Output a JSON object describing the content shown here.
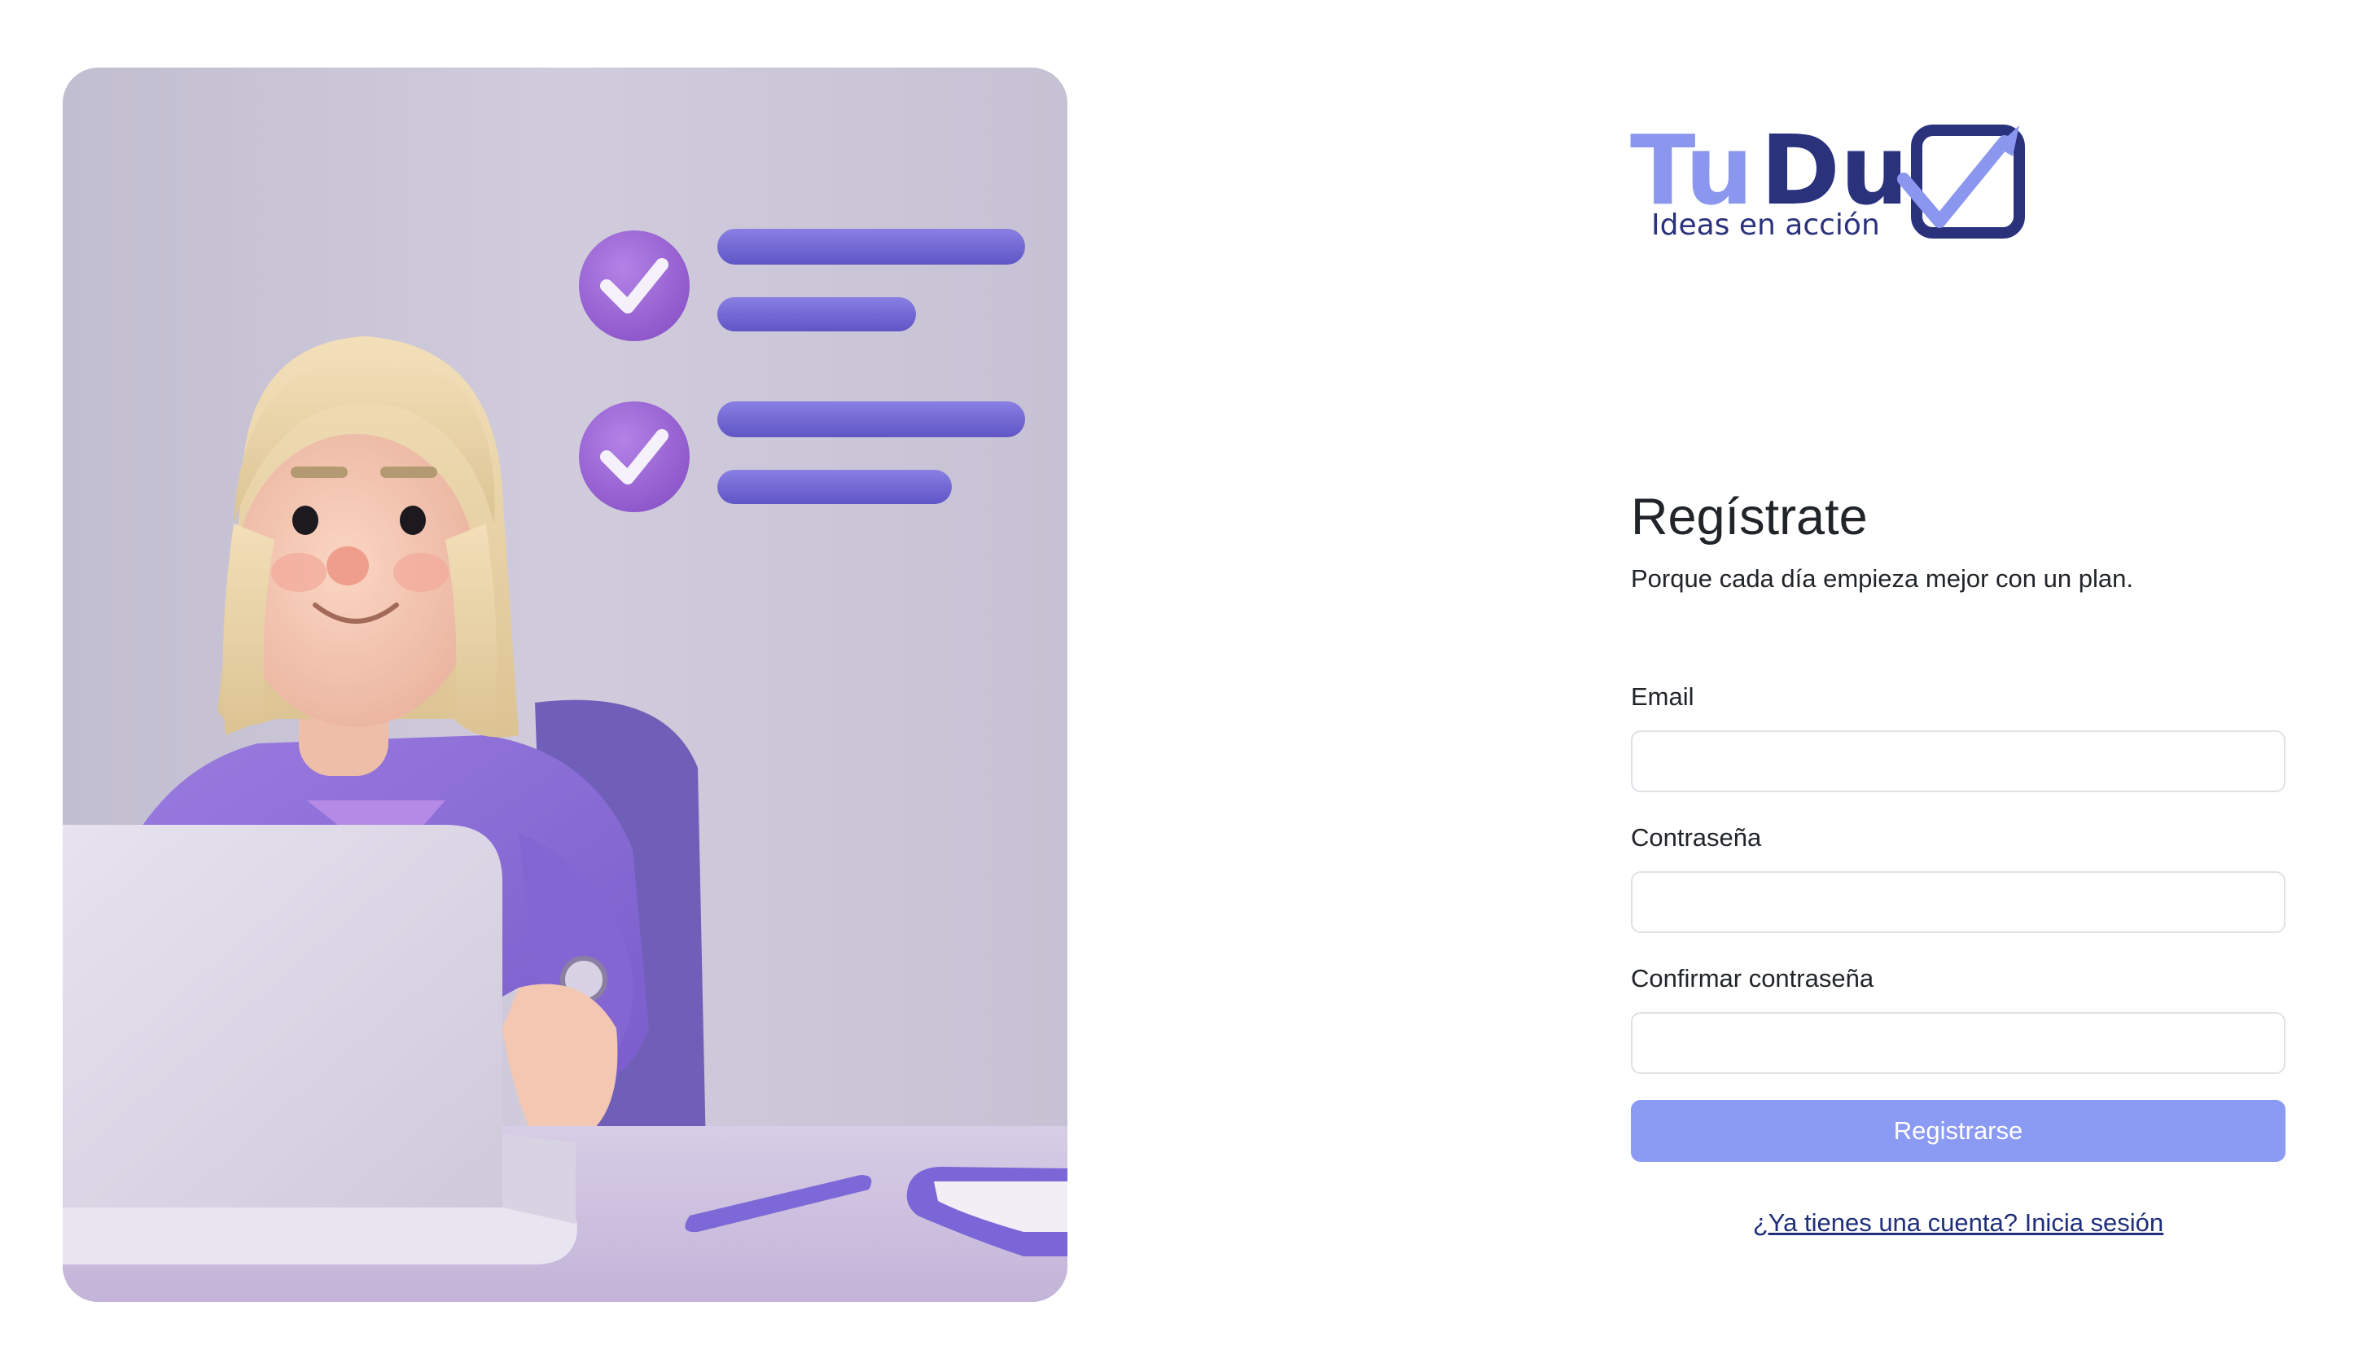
{
  "illustration": {
    "icons": [
      "checkmark-icon",
      "checkmark-icon"
    ]
  },
  "logo": {
    "text_light": "Tu",
    "text_dark": "Du",
    "tagline": "Ideas en acción",
    "icons": [
      "checkbox-rocket-icon"
    ],
    "colors": {
      "light": "#8b96ee",
      "dark": "#2a327c"
    }
  },
  "form": {
    "title": "Regístrate",
    "subtitle": "Porque cada día empieza mejor con un plan.",
    "email_label": "Email",
    "email_value": "",
    "password_label": "Contraseña",
    "password_value": "",
    "confirm_label": "Confirmar contraseña",
    "confirm_value": "",
    "submit_label": "Registrarse",
    "login_link": "¿Ya tienes una cuenta? Inicia sesión"
  },
  "colors": {
    "accent": "#8b9af2",
    "link": "#1f2f7a",
    "input_border": "#dee2e6"
  }
}
